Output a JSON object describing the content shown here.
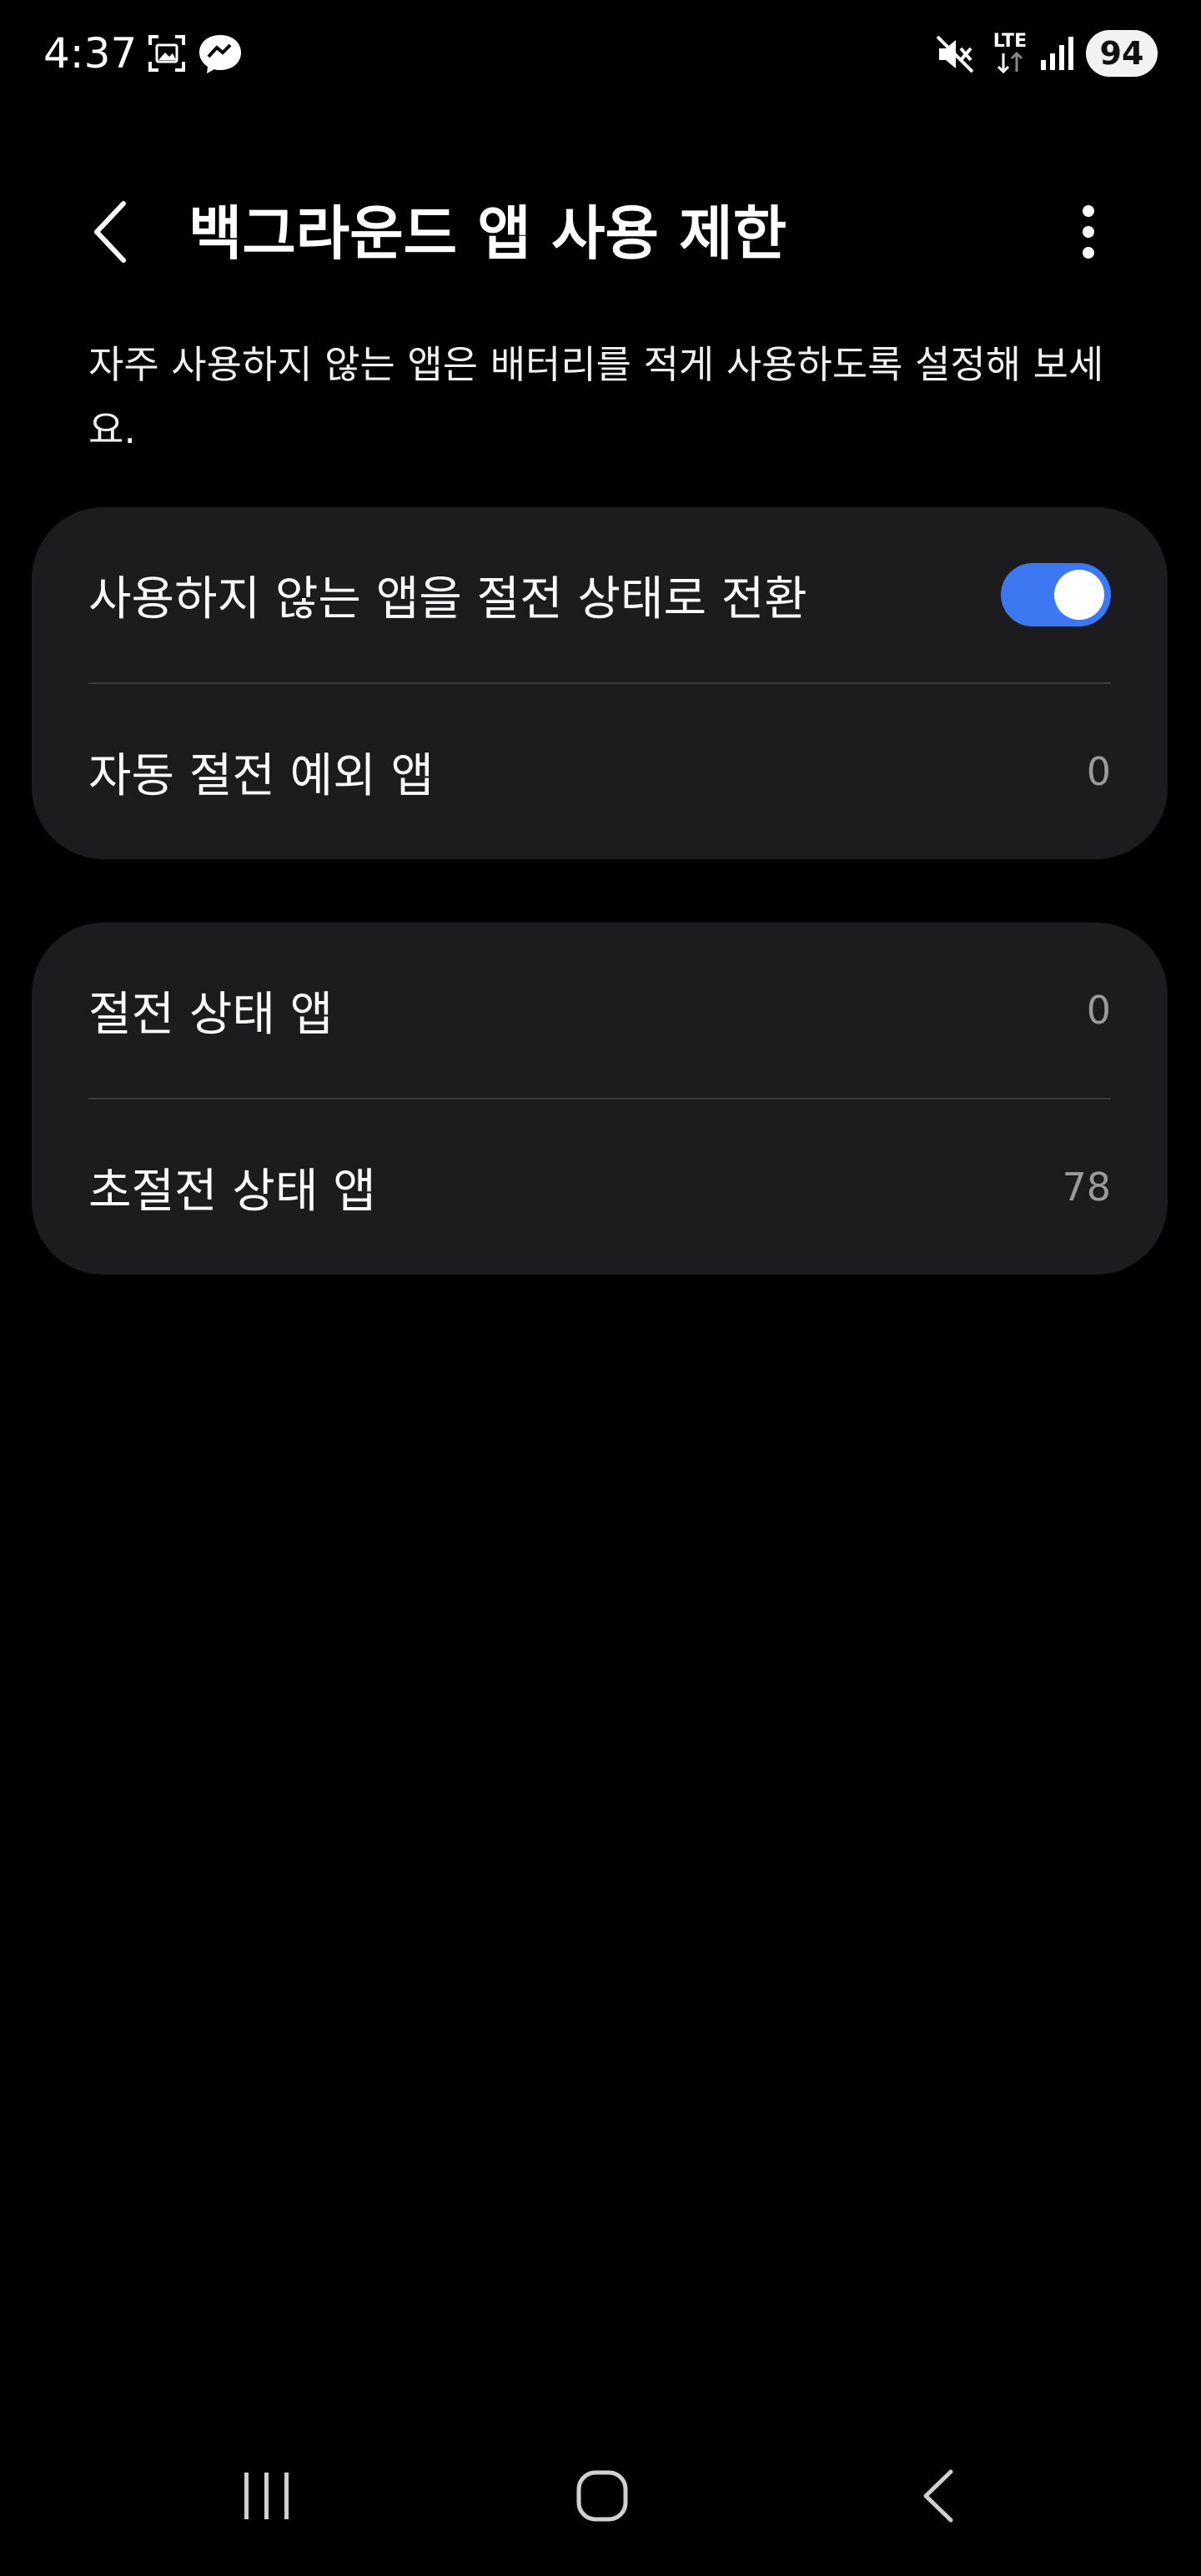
{
  "status_bar": {
    "time": "4:37",
    "icons": [
      "screenshot-icon",
      "messenger-icon",
      "mute-icon",
      "lte-signal-icon",
      "cell-signal-icon"
    ],
    "network_label": "LTE",
    "battery": "94"
  },
  "header": {
    "title": "백그라운드 앱 사용 제한",
    "back_icon": "chevron-left-icon",
    "more_icon": "more-vertical-icon"
  },
  "description": "자주 사용하지 않는 앱은 배터리를 적게 사용하도록 설정해 보세요.",
  "settings_group_1": {
    "toggle_row": {
      "label": "사용하지 않는 앱을 절전 상태로 전환",
      "enabled": true
    },
    "exception_row": {
      "label": "자동 절전 예외 앱",
      "count": "0"
    }
  },
  "settings_group_2": {
    "sleeping_row": {
      "label": "절전 상태 앱",
      "count": "0"
    },
    "deep_sleeping_row": {
      "label": "초절전 상태 앱",
      "count": "78"
    }
  },
  "nav_bar": {
    "recents_icon": "recents-icon",
    "home_icon": "home-icon",
    "back_icon": "back-icon"
  },
  "colors": {
    "background": "#000000",
    "card": "#1c1c1e",
    "accent": "#3b78f2",
    "divider": "#3a3a3c",
    "secondary_text": "#9a9a9a"
  }
}
